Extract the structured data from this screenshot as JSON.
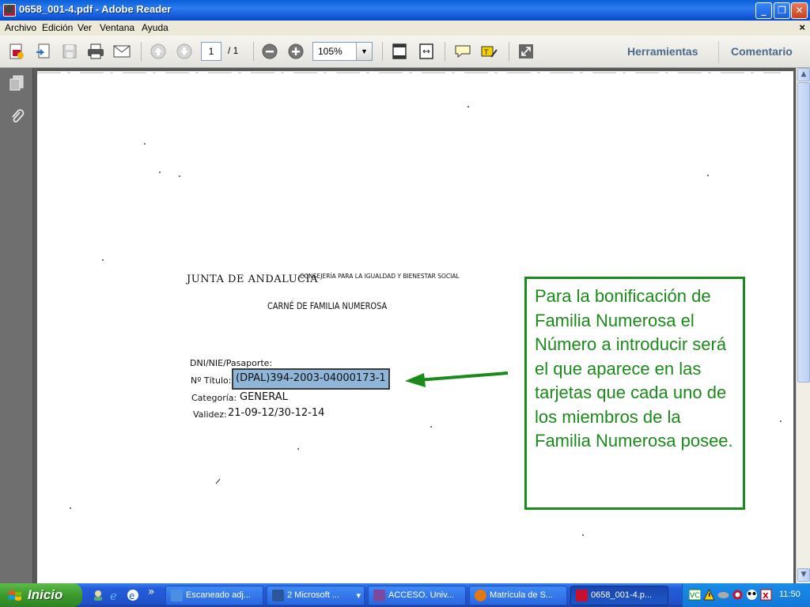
{
  "window": {
    "title": "0658_001-4.pdf - Adobe Reader",
    "app_icon_glyph": "⬛",
    "min_glyph": "_",
    "max_glyph": "❐",
    "close_glyph": "✕"
  },
  "menubar": {
    "items": [
      "Archivo",
      "Edición",
      "Ver",
      "Ventana",
      "Ayuda"
    ],
    "close_glyph": "×"
  },
  "toolbar": {
    "page_current": "1",
    "page_total": "/ 1",
    "zoom": "105%",
    "zoom_drop_glyph": "▼",
    "herramientas": "Herramientas",
    "comentario": "Comentario"
  },
  "document": {
    "header_left": "JUNTA DE ANDALUCIA",
    "header_right": "CONSEJERÍA PARA LA IGUALDAD Y BIENESTAR SOCIAL",
    "card_title": "CARNÉ DE FAMILIA NUMEROSA",
    "dni_label": "DNI/NIE/Pasaporte:",
    "titulo_label": "Nº Título:",
    "titulo_value": "(DPAL)394-2003-04000173-1",
    "categoria_label": "Categoría:",
    "categoria_value": "GENERAL",
    "validez_label": "Validez:",
    "validez_value": "21-09-12/30-12-14",
    "annotation": "Para la bonificación de Familia Numerosa el Número a introducir será el que aparece en las tarjetas que cada uno de los miembros de la Familia Numerosa posee."
  },
  "scrollbar": {
    "up_glyph": "▲",
    "down_glyph": "▼"
  },
  "taskbar": {
    "start_label": "Inicio",
    "more_glyph": "»",
    "tasks": [
      {
        "label": "Escaneado adj...",
        "color": "#4a90e2"
      },
      {
        "label": "2 Microsoft ...",
        "color": "#2b579a"
      },
      {
        "label": "ACCESO.  Univ...",
        "color": "#7a4a9e"
      },
      {
        "label": "Matrícula de S...",
        "color": "#e07a10"
      },
      {
        "label": "0658_001-4.p...",
        "color": "#c8102e"
      }
    ],
    "task_dropdown_glyph": "▾",
    "clock": "11:50"
  },
  "colors": {
    "annotation_green": "#1a8a1a",
    "highlight_blue": "#8fb6d9"
  }
}
